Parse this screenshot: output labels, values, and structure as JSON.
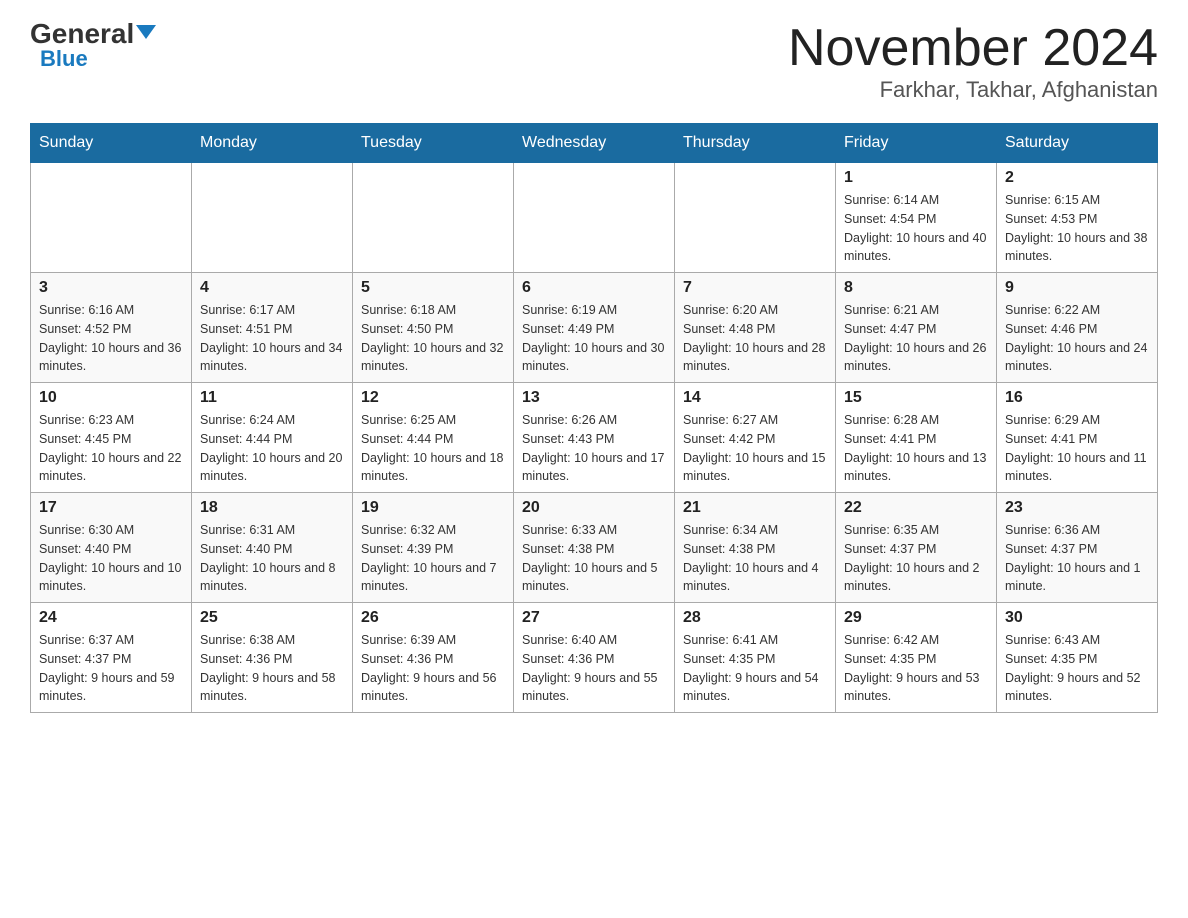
{
  "header": {
    "title": "November 2024",
    "subtitle": "Farkhar, Takhar, Afghanistan",
    "logo_general": "General",
    "logo_blue": "Blue"
  },
  "days_of_week": [
    "Sunday",
    "Monday",
    "Tuesday",
    "Wednesday",
    "Thursday",
    "Friday",
    "Saturday"
  ],
  "weeks": [
    [
      {
        "day": "",
        "sunrise": "",
        "sunset": "",
        "daylight": ""
      },
      {
        "day": "",
        "sunrise": "",
        "sunset": "",
        "daylight": ""
      },
      {
        "day": "",
        "sunrise": "",
        "sunset": "",
        "daylight": ""
      },
      {
        "day": "",
        "sunrise": "",
        "sunset": "",
        "daylight": ""
      },
      {
        "day": "",
        "sunrise": "",
        "sunset": "",
        "daylight": ""
      },
      {
        "day": "1",
        "sunrise": "Sunrise: 6:14 AM",
        "sunset": "Sunset: 4:54 PM",
        "daylight": "Daylight: 10 hours and 40 minutes."
      },
      {
        "day": "2",
        "sunrise": "Sunrise: 6:15 AM",
        "sunset": "Sunset: 4:53 PM",
        "daylight": "Daylight: 10 hours and 38 minutes."
      }
    ],
    [
      {
        "day": "3",
        "sunrise": "Sunrise: 6:16 AM",
        "sunset": "Sunset: 4:52 PM",
        "daylight": "Daylight: 10 hours and 36 minutes."
      },
      {
        "day": "4",
        "sunrise": "Sunrise: 6:17 AM",
        "sunset": "Sunset: 4:51 PM",
        "daylight": "Daylight: 10 hours and 34 minutes."
      },
      {
        "day": "5",
        "sunrise": "Sunrise: 6:18 AM",
        "sunset": "Sunset: 4:50 PM",
        "daylight": "Daylight: 10 hours and 32 minutes."
      },
      {
        "day": "6",
        "sunrise": "Sunrise: 6:19 AM",
        "sunset": "Sunset: 4:49 PM",
        "daylight": "Daylight: 10 hours and 30 minutes."
      },
      {
        "day": "7",
        "sunrise": "Sunrise: 6:20 AM",
        "sunset": "Sunset: 4:48 PM",
        "daylight": "Daylight: 10 hours and 28 minutes."
      },
      {
        "day": "8",
        "sunrise": "Sunrise: 6:21 AM",
        "sunset": "Sunset: 4:47 PM",
        "daylight": "Daylight: 10 hours and 26 minutes."
      },
      {
        "day": "9",
        "sunrise": "Sunrise: 6:22 AM",
        "sunset": "Sunset: 4:46 PM",
        "daylight": "Daylight: 10 hours and 24 minutes."
      }
    ],
    [
      {
        "day": "10",
        "sunrise": "Sunrise: 6:23 AM",
        "sunset": "Sunset: 4:45 PM",
        "daylight": "Daylight: 10 hours and 22 minutes."
      },
      {
        "day": "11",
        "sunrise": "Sunrise: 6:24 AM",
        "sunset": "Sunset: 4:44 PM",
        "daylight": "Daylight: 10 hours and 20 minutes."
      },
      {
        "day": "12",
        "sunrise": "Sunrise: 6:25 AM",
        "sunset": "Sunset: 4:44 PM",
        "daylight": "Daylight: 10 hours and 18 minutes."
      },
      {
        "day": "13",
        "sunrise": "Sunrise: 6:26 AM",
        "sunset": "Sunset: 4:43 PM",
        "daylight": "Daylight: 10 hours and 17 minutes."
      },
      {
        "day": "14",
        "sunrise": "Sunrise: 6:27 AM",
        "sunset": "Sunset: 4:42 PM",
        "daylight": "Daylight: 10 hours and 15 minutes."
      },
      {
        "day": "15",
        "sunrise": "Sunrise: 6:28 AM",
        "sunset": "Sunset: 4:41 PM",
        "daylight": "Daylight: 10 hours and 13 minutes."
      },
      {
        "day": "16",
        "sunrise": "Sunrise: 6:29 AM",
        "sunset": "Sunset: 4:41 PM",
        "daylight": "Daylight: 10 hours and 11 minutes."
      }
    ],
    [
      {
        "day": "17",
        "sunrise": "Sunrise: 6:30 AM",
        "sunset": "Sunset: 4:40 PM",
        "daylight": "Daylight: 10 hours and 10 minutes."
      },
      {
        "day": "18",
        "sunrise": "Sunrise: 6:31 AM",
        "sunset": "Sunset: 4:40 PM",
        "daylight": "Daylight: 10 hours and 8 minutes."
      },
      {
        "day": "19",
        "sunrise": "Sunrise: 6:32 AM",
        "sunset": "Sunset: 4:39 PM",
        "daylight": "Daylight: 10 hours and 7 minutes."
      },
      {
        "day": "20",
        "sunrise": "Sunrise: 6:33 AM",
        "sunset": "Sunset: 4:38 PM",
        "daylight": "Daylight: 10 hours and 5 minutes."
      },
      {
        "day": "21",
        "sunrise": "Sunrise: 6:34 AM",
        "sunset": "Sunset: 4:38 PM",
        "daylight": "Daylight: 10 hours and 4 minutes."
      },
      {
        "day": "22",
        "sunrise": "Sunrise: 6:35 AM",
        "sunset": "Sunset: 4:37 PM",
        "daylight": "Daylight: 10 hours and 2 minutes."
      },
      {
        "day": "23",
        "sunrise": "Sunrise: 6:36 AM",
        "sunset": "Sunset: 4:37 PM",
        "daylight": "Daylight: 10 hours and 1 minute."
      }
    ],
    [
      {
        "day": "24",
        "sunrise": "Sunrise: 6:37 AM",
        "sunset": "Sunset: 4:37 PM",
        "daylight": "Daylight: 9 hours and 59 minutes."
      },
      {
        "day": "25",
        "sunrise": "Sunrise: 6:38 AM",
        "sunset": "Sunset: 4:36 PM",
        "daylight": "Daylight: 9 hours and 58 minutes."
      },
      {
        "day": "26",
        "sunrise": "Sunrise: 6:39 AM",
        "sunset": "Sunset: 4:36 PM",
        "daylight": "Daylight: 9 hours and 56 minutes."
      },
      {
        "day": "27",
        "sunrise": "Sunrise: 6:40 AM",
        "sunset": "Sunset: 4:36 PM",
        "daylight": "Daylight: 9 hours and 55 minutes."
      },
      {
        "day": "28",
        "sunrise": "Sunrise: 6:41 AM",
        "sunset": "Sunset: 4:35 PM",
        "daylight": "Daylight: 9 hours and 54 minutes."
      },
      {
        "day": "29",
        "sunrise": "Sunrise: 6:42 AM",
        "sunset": "Sunset: 4:35 PM",
        "daylight": "Daylight: 9 hours and 53 minutes."
      },
      {
        "day": "30",
        "sunrise": "Sunrise: 6:43 AM",
        "sunset": "Sunset: 4:35 PM",
        "daylight": "Daylight: 9 hours and 52 minutes."
      }
    ]
  ]
}
